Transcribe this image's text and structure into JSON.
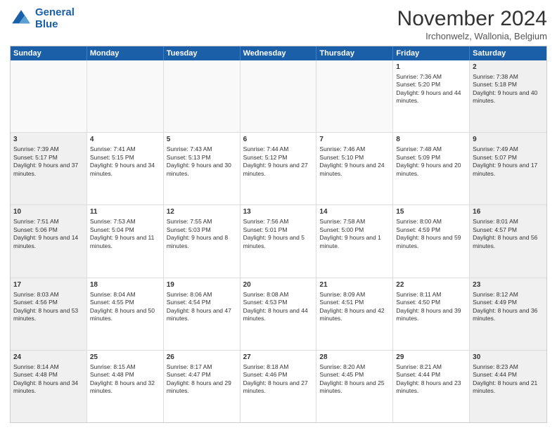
{
  "logo": {
    "line1": "General",
    "line2": "Blue"
  },
  "title": "November 2024",
  "subtitle": "Irchonwelz, Wallonia, Belgium",
  "days": [
    "Sunday",
    "Monday",
    "Tuesday",
    "Wednesday",
    "Thursday",
    "Friday",
    "Saturday"
  ],
  "weeks": [
    [
      {
        "num": "",
        "info": ""
      },
      {
        "num": "",
        "info": ""
      },
      {
        "num": "",
        "info": ""
      },
      {
        "num": "",
        "info": ""
      },
      {
        "num": "",
        "info": ""
      },
      {
        "num": "1",
        "info": "Sunrise: 7:36 AM\nSunset: 5:20 PM\nDaylight: 9 hours and 44 minutes."
      },
      {
        "num": "2",
        "info": "Sunrise: 7:38 AM\nSunset: 5:18 PM\nDaylight: 9 hours and 40 minutes."
      }
    ],
    [
      {
        "num": "3",
        "info": "Sunrise: 7:39 AM\nSunset: 5:17 PM\nDaylight: 9 hours and 37 minutes."
      },
      {
        "num": "4",
        "info": "Sunrise: 7:41 AM\nSunset: 5:15 PM\nDaylight: 9 hours and 34 minutes."
      },
      {
        "num": "5",
        "info": "Sunrise: 7:43 AM\nSunset: 5:13 PM\nDaylight: 9 hours and 30 minutes."
      },
      {
        "num": "6",
        "info": "Sunrise: 7:44 AM\nSunset: 5:12 PM\nDaylight: 9 hours and 27 minutes."
      },
      {
        "num": "7",
        "info": "Sunrise: 7:46 AM\nSunset: 5:10 PM\nDaylight: 9 hours and 24 minutes."
      },
      {
        "num": "8",
        "info": "Sunrise: 7:48 AM\nSunset: 5:09 PM\nDaylight: 9 hours and 20 minutes."
      },
      {
        "num": "9",
        "info": "Sunrise: 7:49 AM\nSunset: 5:07 PM\nDaylight: 9 hours and 17 minutes."
      }
    ],
    [
      {
        "num": "10",
        "info": "Sunrise: 7:51 AM\nSunset: 5:06 PM\nDaylight: 9 hours and 14 minutes."
      },
      {
        "num": "11",
        "info": "Sunrise: 7:53 AM\nSunset: 5:04 PM\nDaylight: 9 hours and 11 minutes."
      },
      {
        "num": "12",
        "info": "Sunrise: 7:55 AM\nSunset: 5:03 PM\nDaylight: 9 hours and 8 minutes."
      },
      {
        "num": "13",
        "info": "Sunrise: 7:56 AM\nSunset: 5:01 PM\nDaylight: 9 hours and 5 minutes."
      },
      {
        "num": "14",
        "info": "Sunrise: 7:58 AM\nSunset: 5:00 PM\nDaylight: 9 hours and 1 minute."
      },
      {
        "num": "15",
        "info": "Sunrise: 8:00 AM\nSunset: 4:59 PM\nDaylight: 8 hours and 59 minutes."
      },
      {
        "num": "16",
        "info": "Sunrise: 8:01 AM\nSunset: 4:57 PM\nDaylight: 8 hours and 56 minutes."
      }
    ],
    [
      {
        "num": "17",
        "info": "Sunrise: 8:03 AM\nSunset: 4:56 PM\nDaylight: 8 hours and 53 minutes."
      },
      {
        "num": "18",
        "info": "Sunrise: 8:04 AM\nSunset: 4:55 PM\nDaylight: 8 hours and 50 minutes."
      },
      {
        "num": "19",
        "info": "Sunrise: 8:06 AM\nSunset: 4:54 PM\nDaylight: 8 hours and 47 minutes."
      },
      {
        "num": "20",
        "info": "Sunrise: 8:08 AM\nSunset: 4:53 PM\nDaylight: 8 hours and 44 minutes."
      },
      {
        "num": "21",
        "info": "Sunrise: 8:09 AM\nSunset: 4:51 PM\nDaylight: 8 hours and 42 minutes."
      },
      {
        "num": "22",
        "info": "Sunrise: 8:11 AM\nSunset: 4:50 PM\nDaylight: 8 hours and 39 minutes."
      },
      {
        "num": "23",
        "info": "Sunrise: 8:12 AM\nSunset: 4:49 PM\nDaylight: 8 hours and 36 minutes."
      }
    ],
    [
      {
        "num": "24",
        "info": "Sunrise: 8:14 AM\nSunset: 4:48 PM\nDaylight: 8 hours and 34 minutes."
      },
      {
        "num": "25",
        "info": "Sunrise: 8:15 AM\nSunset: 4:48 PM\nDaylight: 8 hours and 32 minutes."
      },
      {
        "num": "26",
        "info": "Sunrise: 8:17 AM\nSunset: 4:47 PM\nDaylight: 8 hours and 29 minutes."
      },
      {
        "num": "27",
        "info": "Sunrise: 8:18 AM\nSunset: 4:46 PM\nDaylight: 8 hours and 27 minutes."
      },
      {
        "num": "28",
        "info": "Sunrise: 8:20 AM\nSunset: 4:45 PM\nDaylight: 8 hours and 25 minutes."
      },
      {
        "num": "29",
        "info": "Sunrise: 8:21 AM\nSunset: 4:44 PM\nDaylight: 8 hours and 23 minutes."
      },
      {
        "num": "30",
        "info": "Sunrise: 8:23 AM\nSunset: 4:44 PM\nDaylight: 8 hours and 21 minutes."
      }
    ]
  ]
}
